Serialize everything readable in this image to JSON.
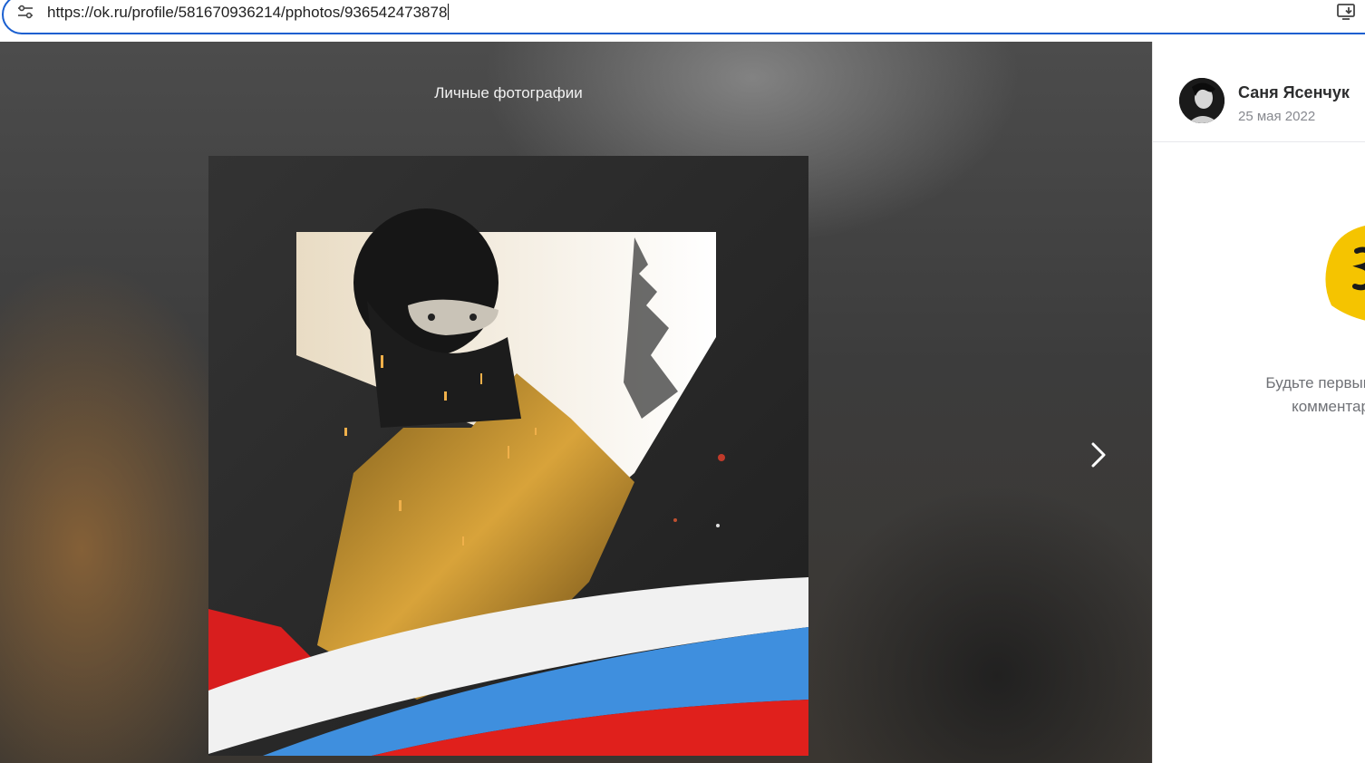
{
  "browser": {
    "url": "https://ok.ru/profile/581670936214/pphotos/936542473878",
    "icons": {
      "site_info": "tune-icon",
      "install": "install-app-icon"
    }
  },
  "viewer": {
    "album_title": "Личные фотографии",
    "next_icon": "chevron-right-icon"
  },
  "sidebar": {
    "author_name": "Саня Ясенчук",
    "date": "25 мая 2022",
    "empty_line1": "Будьте первым, кто оставит",
    "empty_line2": "комментарий к фото"
  },
  "colors": {
    "focus_ring": "#1a5fd0",
    "mascot": "#f5c400"
  }
}
